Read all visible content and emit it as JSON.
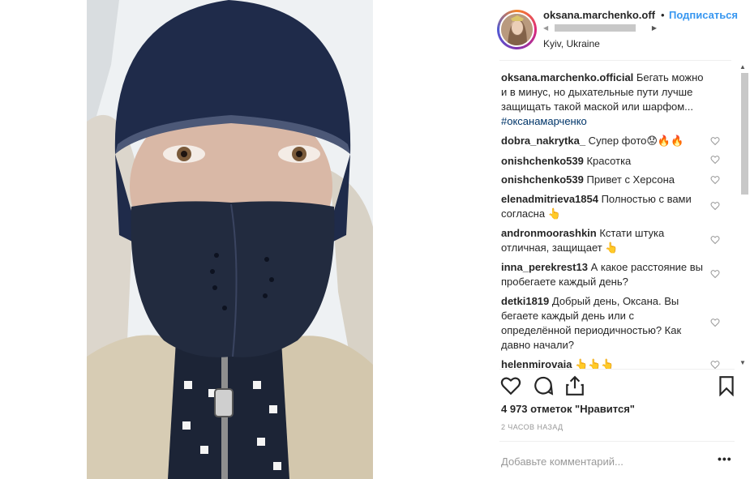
{
  "header": {
    "username": "oksana.marchenko.off",
    "separator": "•",
    "follow_label": "Подписаться",
    "location": "Kyiv, Ukraine"
  },
  "caption": {
    "user": "oksana.marchenko.official",
    "text": " Бегать можно и в минус, но дыхательные пути лучше защищать такой маской или шарфом...",
    "hashtag": "#оксанамарченко"
  },
  "comments": [
    {
      "user": "dobra_nakrytka_",
      "text": " Супер фото😟🔥🔥"
    },
    {
      "user": "onishchenko539",
      "text": " Красотка"
    },
    {
      "user": "onishchenko539",
      "text": " Привет с Херсона"
    },
    {
      "user": "elenadmitrieva1854",
      "text": " Полностью с вами согласна 👆"
    },
    {
      "user": "andronmoorashkin",
      "text": " Кстати штука отличная, защищает 👆"
    },
    {
      "user": "inna_perekrest13",
      "text": " А какое расстояние вы пробегаете каждый день?"
    },
    {
      "user": "detki1819",
      "text": " Добрый день, Оксана. Вы бегаете каждый день или с определённой периодичностью? Как давно начали?"
    },
    {
      "user": "helenmirovaia",
      "text": " 👆👆👆"
    }
  ],
  "likes_text": "4 973 отметок \"Нравится\"",
  "time_ago": "2 ЧАСОВ НАЗАД",
  "add_comment_placeholder": "Добавьте комментарий...",
  "more_label": "•••",
  "icons": {
    "like": "heart-icon",
    "comment": "comment-icon",
    "share": "share-icon",
    "save": "bookmark-icon",
    "comment_like": "heart-small-icon"
  }
}
